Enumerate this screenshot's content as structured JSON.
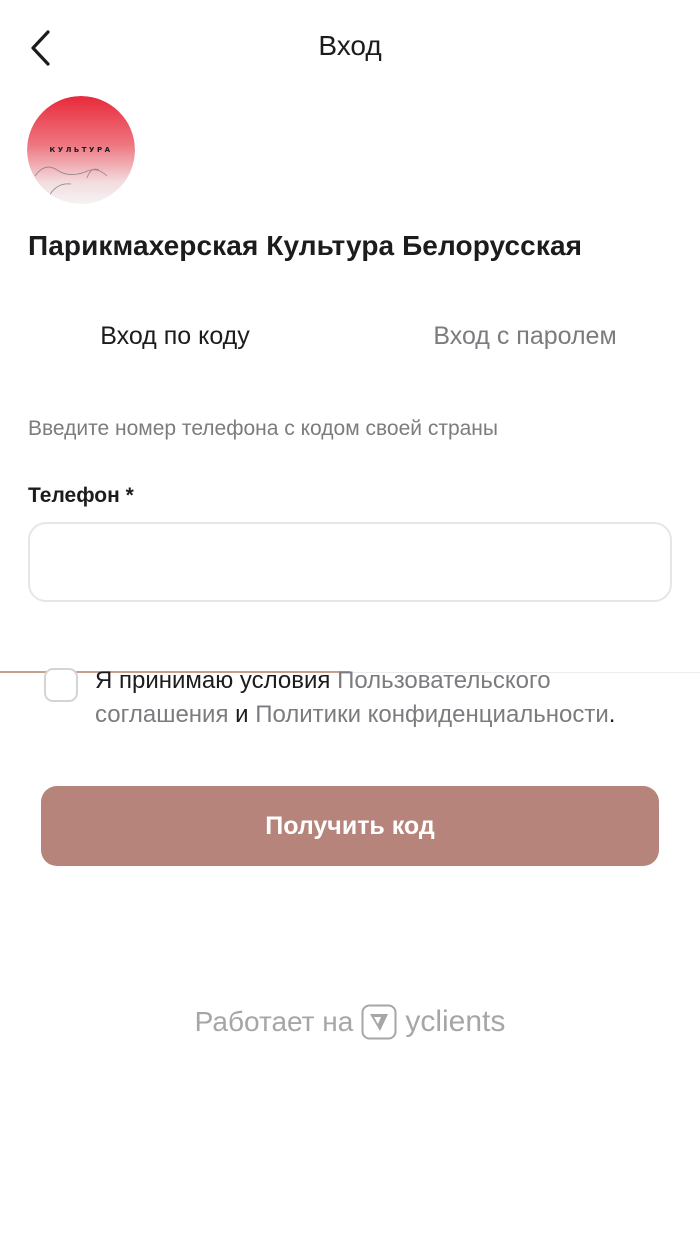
{
  "header": {
    "back_icon": "chevron-left-icon",
    "title": "Вход"
  },
  "logo": {
    "text": "КУЛЬТУРА",
    "colors": {
      "top": "#e63946",
      "bottom": "#f4f4f4"
    }
  },
  "company_name": "Парикмахерская Культура Белорусская",
  "tabs": [
    {
      "label": "Вход по коду",
      "active": true
    },
    {
      "label": "Вход с паролем",
      "active": false
    }
  ],
  "hint": "Введите номер телефона с кодом своей страны",
  "phone": {
    "label": "Телефон *",
    "value": "",
    "placeholder": ""
  },
  "agreement": {
    "prefix": "Я принимаю условия ",
    "terms_link": "Пользовательского соглашения",
    "conjunction": " и ",
    "privacy_link": "Политики конфиденциальности",
    "suffix": ".",
    "checked": false
  },
  "submit_label": "Получить код",
  "footer": {
    "prefix": "Работает на",
    "brand": "yclients",
    "icon": "yclients-logo-icon"
  },
  "colors": {
    "accent": "#b6847b",
    "tab_underline": "#c9a08f",
    "muted_text": "#7c7c80"
  }
}
